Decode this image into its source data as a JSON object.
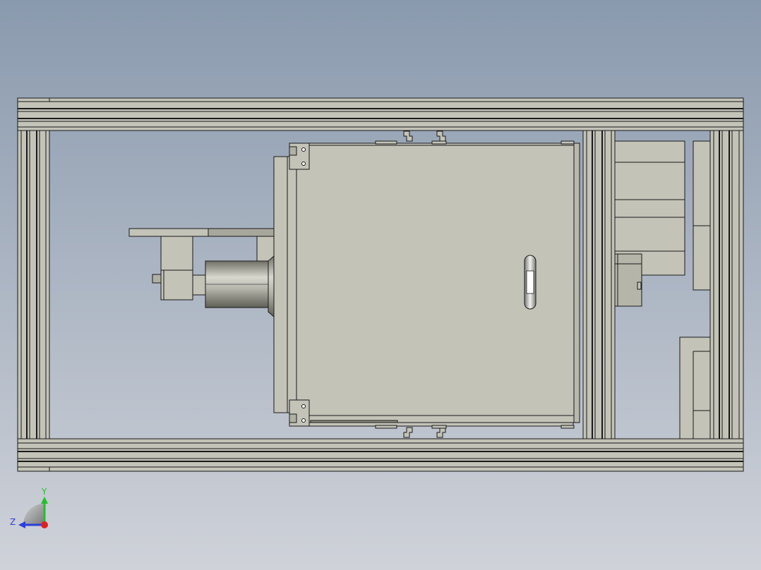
{
  "view": {
    "background_top": "#8c9cb0",
    "background_bottom": "#c9ccd4",
    "part_color": "#c3c3b8",
    "part_dark": "#8f8f84",
    "edge_color": "#1a1a1a"
  },
  "triad": {
    "y_label": "Y",
    "z_label": "Z",
    "y_color": "#22c02a",
    "z_color": "#2c3fd8",
    "x_color": "#e02020"
  }
}
